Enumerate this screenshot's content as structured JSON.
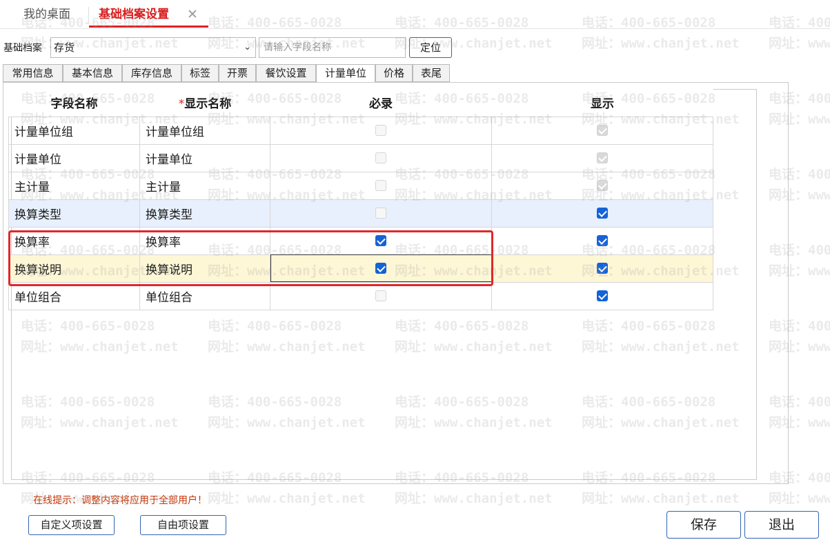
{
  "top_tabs": [
    {
      "label": "我的桌面",
      "active": false
    },
    {
      "label": "基础档案设置",
      "active": true
    }
  ],
  "close_glyph": "✕",
  "filter": {
    "label": "基础档案",
    "select_value": "存货",
    "search_placeholder": "请输入字段名称",
    "locate_label": "定位"
  },
  "sub_tabs": [
    {
      "label": "常用信息",
      "active": false
    },
    {
      "label": "基本信息",
      "active": false
    },
    {
      "label": "库存信息",
      "active": false
    },
    {
      "label": "标签",
      "active": false
    },
    {
      "label": "开票",
      "active": false
    },
    {
      "label": "餐饮设置",
      "active": false
    },
    {
      "label": "计量单位",
      "active": true
    },
    {
      "label": "价格",
      "active": false
    },
    {
      "label": "表尾",
      "active": false
    }
  ],
  "table": {
    "headers": {
      "field_name": "字段名称",
      "display_star": "*",
      "display_name": "显示名称",
      "required": "必录",
      "show": "显示"
    },
    "rows": [
      {
        "field": "计量单位组",
        "display": "计量单位组",
        "required": false,
        "required_disabled": true,
        "show": true,
        "show_disabled": true
      },
      {
        "field": "计量单位",
        "display": "计量单位",
        "required": false,
        "required_disabled": true,
        "show": true,
        "show_disabled": true
      },
      {
        "field": "主计量",
        "display": "主计量",
        "required": false,
        "required_disabled": true,
        "show": true,
        "show_disabled": true
      },
      {
        "field": "换算类型",
        "display": "换算类型",
        "required": false,
        "required_disabled": true,
        "show": true,
        "show_disabled": false
      },
      {
        "field": "换算率",
        "display": "换算率",
        "required": true,
        "required_disabled": false,
        "show": true,
        "show_disabled": false
      },
      {
        "field": "换算说明",
        "display": "换算说明",
        "required": true,
        "required_disabled": false,
        "show": true,
        "show_disabled": false
      },
      {
        "field": "单位组合",
        "display": "单位组合",
        "required": false,
        "required_disabled": true,
        "show": true,
        "show_disabled": false
      }
    ],
    "row_highlight_colors": {
      "selected": "#e7f0fc",
      "hover": "#fdf7d6"
    }
  },
  "watermark": {
    "phone": "电话：400-665-0028",
    "site": "网址：www.chanjet.net"
  },
  "hint": "在线提示：调整内容将应用于全部用户！",
  "buttons": {
    "custom_items": "自定义项设置",
    "free_items": "自由项设置",
    "save": "保存",
    "exit": "退出"
  },
  "colors": {
    "accent_red": "#e02020",
    "checkbox_blue": "#1463d8",
    "button_border": "#2f64b5",
    "hint_text": "#c83200"
  }
}
